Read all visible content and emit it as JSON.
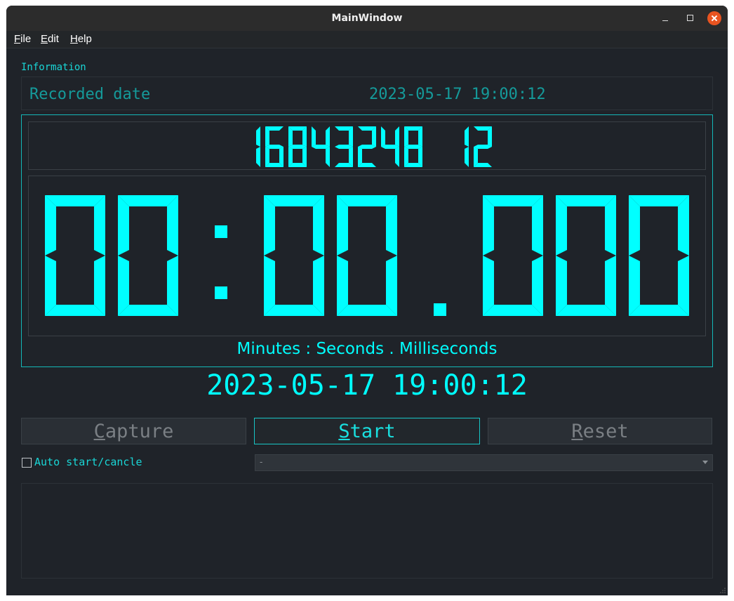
{
  "window": {
    "title": "MainWindow"
  },
  "menu": [
    {
      "id": "file",
      "label": "File"
    },
    {
      "id": "edit",
      "label": "Edit"
    },
    {
      "id": "help",
      "label": "Help"
    }
  ],
  "info": {
    "group_label": "Information",
    "key": "Recorded date",
    "value": "2023-05-17 19:00:12"
  },
  "lcd_small": "16843248 12",
  "lcd_big": "00:00.000",
  "unit_label": "Minutes : Seconds . Milliseconds",
  "big_date": "2023-05-17 19:00:12",
  "buttons": {
    "capture": "Capture",
    "start": "Start",
    "reset": "Reset"
  },
  "auto_label": "Auto start/cancle",
  "auto_checked": false,
  "select_value": "-",
  "colors": {
    "accent": "#00ffff",
    "dim_accent": "#159a9a",
    "background": "#1f2329",
    "close_button": "#e95420"
  },
  "icons": [
    "minimize-icon",
    "maximize-icon",
    "close-icon",
    "chevron-down-icon",
    "resize-grip-icon"
  ]
}
